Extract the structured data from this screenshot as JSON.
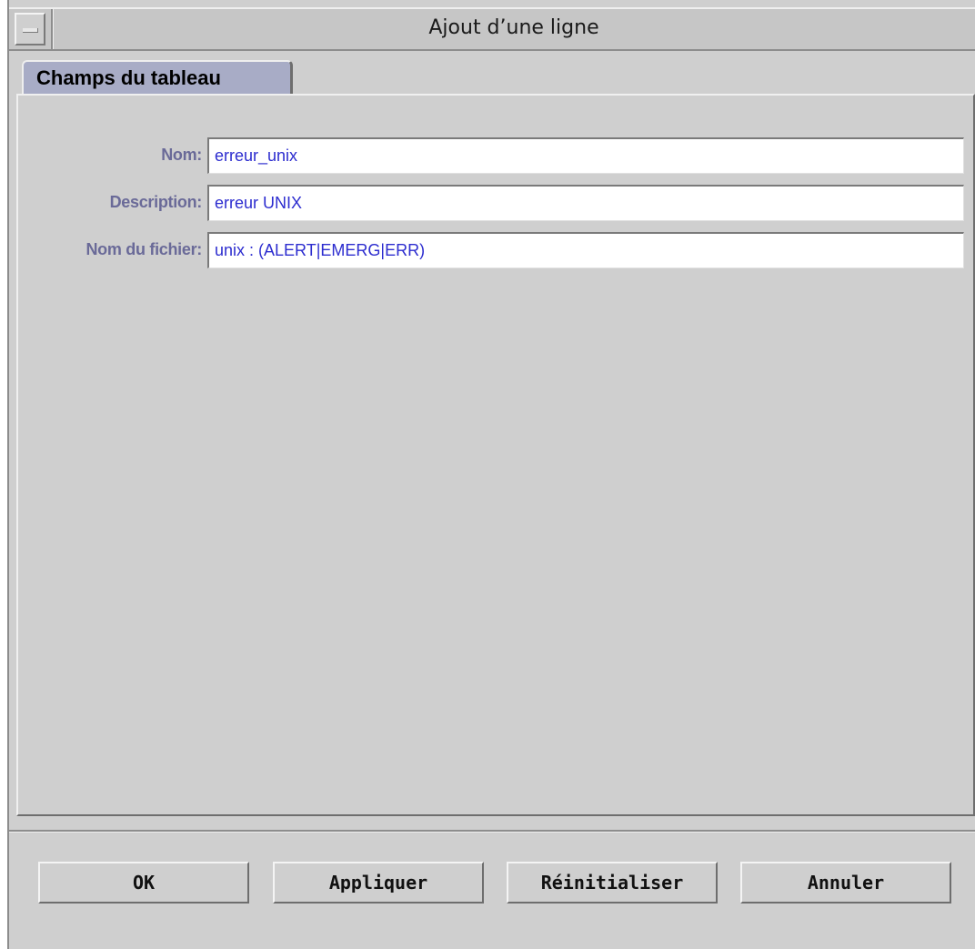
{
  "window": {
    "title": "Ajout d’une ligne"
  },
  "tabs": [
    {
      "label": "Champs du tableau",
      "selected": true
    }
  ],
  "form": {
    "fields": [
      {
        "label": "Nom:",
        "value": "erreur_unix"
      },
      {
        "label": "Description:",
        "value": "erreur UNIX"
      },
      {
        "label": "Nom du fichier:",
        "value": "unix : (ALERT|EMERG|ERR)"
      }
    ]
  },
  "buttons": {
    "ok": "OK",
    "apply": "Appliquer",
    "reset": "Réinitialiser",
    "cancel": "Annuler"
  },
  "colors": {
    "label_text": "#6a6a98",
    "input_text": "#2d2dcf",
    "tab_bg": "#a8acc6",
    "window_bg": "#cfcfcf"
  },
  "icons": {
    "window_menu": "window-menu-icon"
  }
}
